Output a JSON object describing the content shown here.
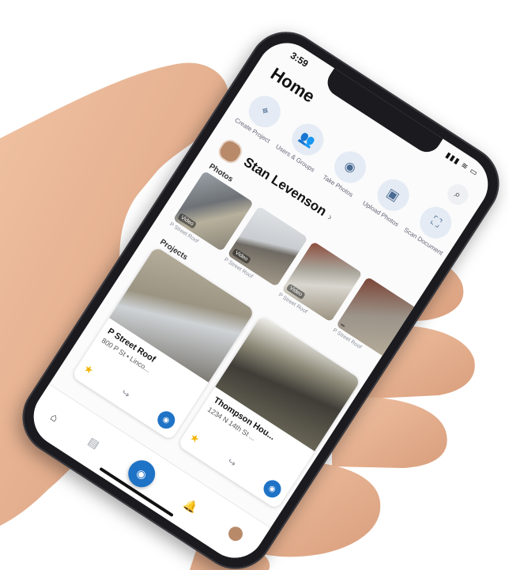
{
  "status": {
    "time": "3:59",
    "icons": "▮▮▮ ≋ ▭"
  },
  "header": {
    "title": "Home"
  },
  "actions": [
    {
      "label": "Create Project",
      "icon": "pin-plus-icon"
    },
    {
      "label": "Users & Groups",
      "icon": "users-icon"
    },
    {
      "label": "Take Photos",
      "icon": "camera-icon"
    },
    {
      "label": "Upload Photos",
      "icon": "image-upload-icon"
    },
    {
      "label": "Scan Document",
      "icon": "scan-icon"
    }
  ],
  "profile": {
    "name": "Stan Levenson"
  },
  "sections": {
    "photos": "Photos",
    "projects": "Projects"
  },
  "photos": [
    {
      "caption": "P Street Roof",
      "badge": "Video"
    },
    {
      "caption": "P Street Roof",
      "badge": "Video"
    },
    {
      "caption": "P Street Roof",
      "badge": "Video"
    },
    {
      "caption": "P Street Roof",
      "badge": ""
    }
  ],
  "projects": [
    {
      "title": "P Street Roof",
      "address": "800 P St • Linco..."
    },
    {
      "title": "Thompson Hou...",
      "address": "1234 N 14th St ..."
    }
  ],
  "colors": {
    "accent": "#1f73c6",
    "star": "#f3b400"
  }
}
